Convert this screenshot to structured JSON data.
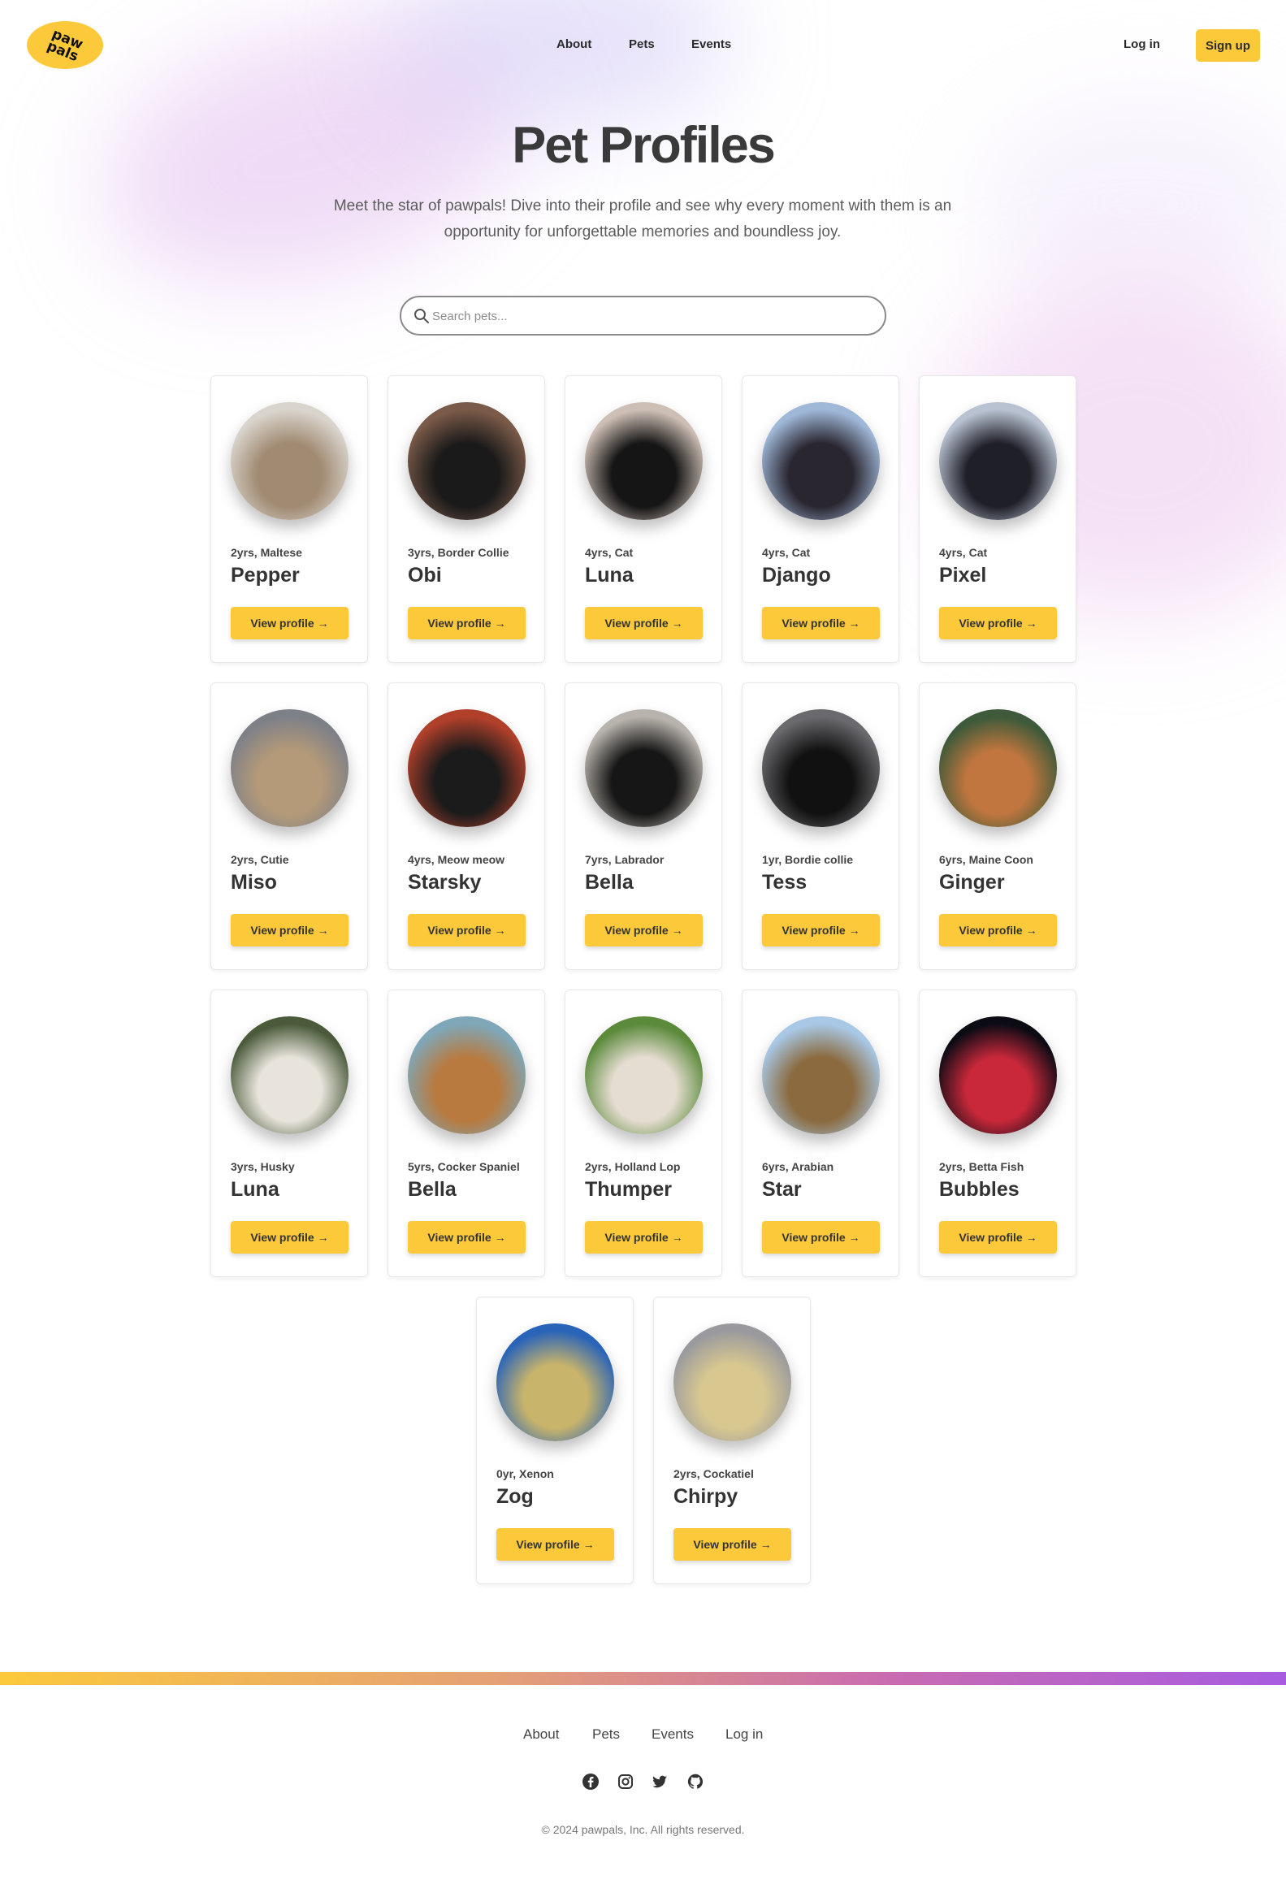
{
  "header": {
    "logo_text": "paw\npals",
    "nav": [
      "About",
      "Pets",
      "Events"
    ],
    "login": "Log in",
    "signup": "Sign up"
  },
  "hero": {
    "title": "Pet Profiles",
    "subtitle": "Meet the star of pawpals! Dive into their profile and see why every moment with them is an opportunity for unforgettable memories and boundless joy."
  },
  "search": {
    "placeholder": "Search pets..."
  },
  "button_label": "View profile →",
  "pets": [
    {
      "meta": "2yrs, Maltese",
      "name": "Pepper",
      "colors": [
        "#d9d4cc",
        "#a08a72"
      ]
    },
    {
      "meta": "3yrs, Border Collie",
      "name": "Obi",
      "colors": [
        "#7a5a48",
        "#1a1a1a"
      ]
    },
    {
      "meta": "4yrs, Cat",
      "name": "Luna",
      "colors": [
        "#cdbfb5",
        "#151515"
      ]
    },
    {
      "meta": "4yrs, Cat",
      "name": "Django",
      "colors": [
        "#9fb8d8",
        "#2a2630"
      ]
    },
    {
      "meta": "4yrs, Cat",
      "name": "Pixel",
      "colors": [
        "#b8c2d0",
        "#1f1f28"
      ]
    },
    {
      "meta": "2yrs, Cutie",
      "name": "Miso",
      "colors": [
        "#7e8088",
        "#b49a78"
      ]
    },
    {
      "meta": "4yrs, Meow meow",
      "name": "Starsky",
      "colors": [
        "#b0402a",
        "#1b1b1b"
      ]
    },
    {
      "meta": "7yrs, Labrador",
      "name": "Bella",
      "colors": [
        "#b8b3ac",
        "#161616"
      ]
    },
    {
      "meta": "1yr, Bordie collie",
      "name": "Tess",
      "colors": [
        "#6a6a6e",
        "#111111"
      ]
    },
    {
      "meta": "6yrs, Maine Coon",
      "name": "Ginger",
      "colors": [
        "#3e5a3a",
        "#c0763e"
      ]
    },
    {
      "meta": "3yrs, Husky",
      "name": "Luna",
      "colors": [
        "#4a5a3a",
        "#e8e4dc"
      ]
    },
    {
      "meta": "5yrs, Cocker Spaniel",
      "name": "Bella",
      "colors": [
        "#7fa7b8",
        "#b87a3e"
      ]
    },
    {
      "meta": "2yrs, Holland Lop",
      "name": "Thumper",
      "colors": [
        "#5a8a3a",
        "#e6ddd2"
      ]
    },
    {
      "meta": "6yrs, Arabian",
      "name": "Star",
      "colors": [
        "#a8c8e6",
        "#8a6a3e"
      ]
    },
    {
      "meta": "2yrs, Betta Fish",
      "name": "Bubbles",
      "colors": [
        "#0b0b14",
        "#c8283a"
      ]
    },
    {
      "meta": "0yr, Xenon",
      "name": "Zog",
      "colors": [
        "#2a64b8",
        "#c8b46a"
      ]
    },
    {
      "meta": "2yrs, Cockatiel",
      "name": "Chirpy",
      "colors": [
        "#9a9a9e",
        "#d8c890"
      ]
    }
  ],
  "footer": {
    "links": [
      "About",
      "Pets",
      "Events",
      "Log in"
    ],
    "social_icons": [
      "facebook-icon",
      "instagram-icon",
      "twitter-icon",
      "github-icon"
    ],
    "copyright": "© 2024 pawpals, Inc. All rights reserved."
  },
  "colors": {
    "accent": "#fcc93b",
    "text": "#3a3a3a"
  }
}
